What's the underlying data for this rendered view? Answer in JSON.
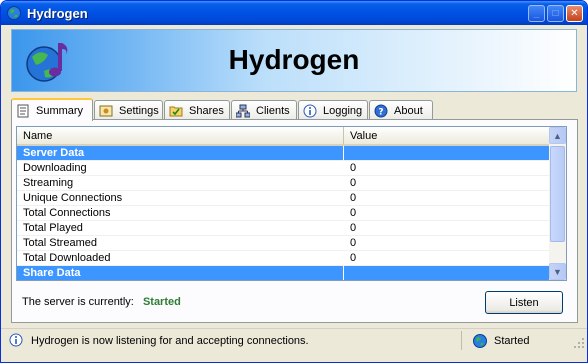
{
  "window": {
    "title": "Hydrogen"
  },
  "banner": {
    "title": "Hydrogen"
  },
  "tabs": [
    {
      "label": "Summary",
      "icon": "document-icon"
    },
    {
      "label": "Settings",
      "icon": "settings-icon"
    },
    {
      "label": "Shares",
      "icon": "folder-check-icon"
    },
    {
      "label": "Clients",
      "icon": "network-icon"
    },
    {
      "label": "Logging",
      "icon": "info-icon"
    },
    {
      "label": "About",
      "icon": "help-icon"
    }
  ],
  "list": {
    "headers": [
      "Name",
      "Value"
    ],
    "rows": [
      {
        "name": "Server Data",
        "value": "",
        "group": true
      },
      {
        "name": "Downloading",
        "value": "0"
      },
      {
        "name": "Streaming",
        "value": "0"
      },
      {
        "name": "Unique Connections",
        "value": "0"
      },
      {
        "name": "Total Connections",
        "value": "0"
      },
      {
        "name": "Total Played",
        "value": "0"
      },
      {
        "name": "Total Streamed",
        "value": "0"
      },
      {
        "name": "Total Downloaded",
        "value": "0"
      },
      {
        "name": "Share Data",
        "value": "",
        "group": true
      }
    ]
  },
  "server_status": {
    "label": "The server is currently:",
    "value": "Started"
  },
  "listen_button": "Listen",
  "statusbar": {
    "message": "Hydrogen is now listening for and accepting connections.",
    "state": "Started"
  },
  "colors": {
    "selected_row": "#3d95ff",
    "started": "#2e7d32"
  }
}
